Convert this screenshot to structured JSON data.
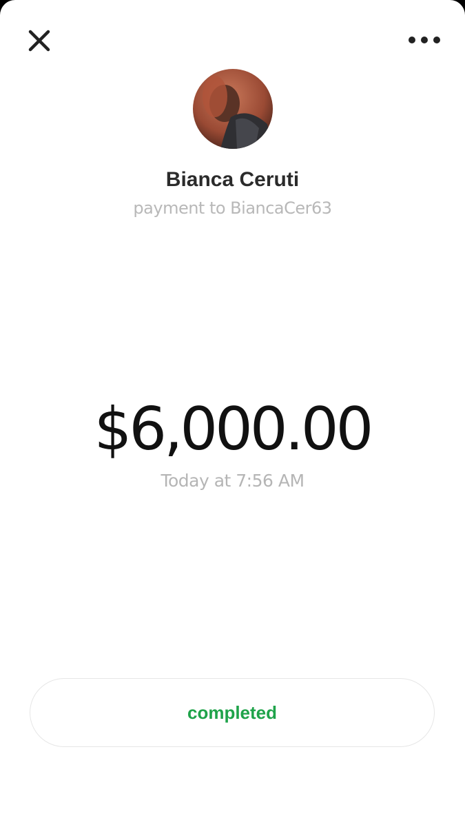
{
  "header": {
    "close_icon": "close-icon",
    "more_icon": "more-horizontal-icon"
  },
  "recipient": {
    "name": "Bianca Ceruti",
    "subtitle": "payment to BiancaCer63"
  },
  "payment": {
    "amount": "$6,000.00",
    "timestamp": "Today at 7:56 AM"
  },
  "status": {
    "label": "completed",
    "color": "#1fa34a"
  }
}
